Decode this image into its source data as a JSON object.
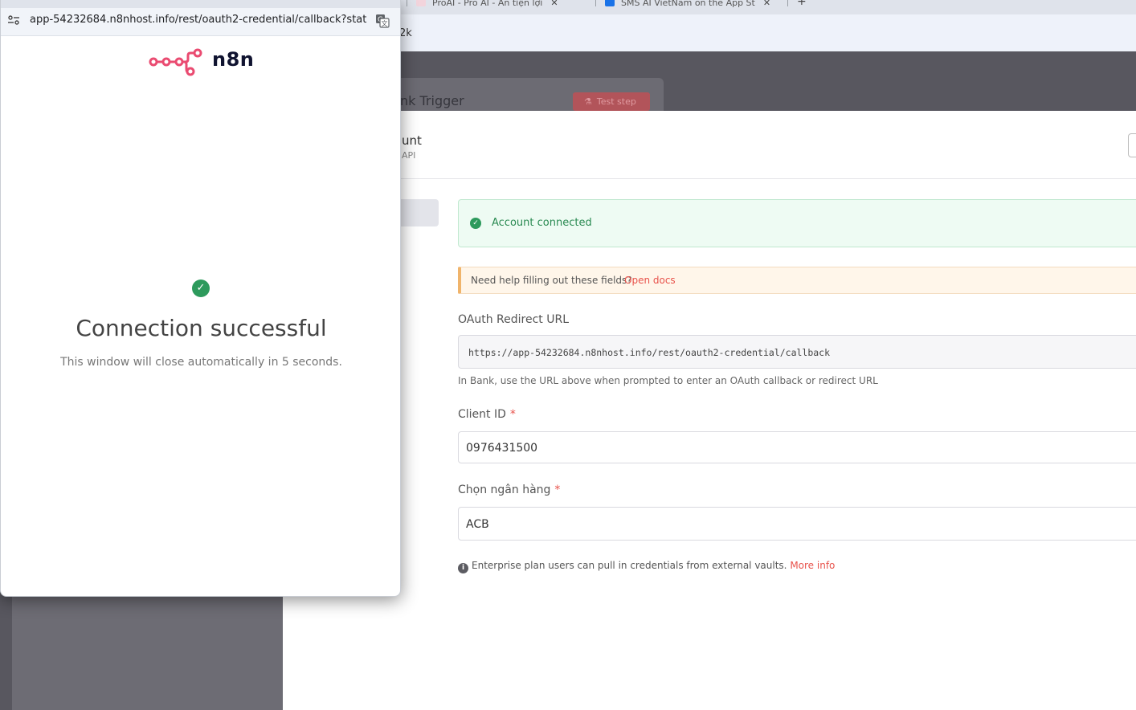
{
  "browser": {
    "tabs": [
      {
        "label": "ProAI - Pro AI - An tiện lợi",
        "color": "#f2d4dc"
      },
      {
        "label": "SMS AI VietNam on the App St",
        "color": "#1a73e8"
      }
    ],
    "background_url_fragment": "2k"
  },
  "popup": {
    "url": "app-54232684.n8nhost.info/rest/oauth2-credential/callback?state...",
    "logo_text": "n8n",
    "title": "Connection successful",
    "subtitle": "This window will close automatically in 5 seconds."
  },
  "ndv": {
    "title": "nk Trigger",
    "test_step_label": "Test step"
  },
  "credential": {
    "title": "unt",
    "subtitle": "API",
    "success_banner": "Account connected",
    "help_text": "Need help filling out these fields?",
    "help_link": "Open docs",
    "redirect_label": "OAuth Redirect URL",
    "redirect_value": "https://app-54232684.n8nhost.info/rest/oauth2-credential/callback",
    "redirect_hint": "In Bank, use the URL above when prompted to enter an OAuth callback or redirect URL",
    "client_id_label": "Client ID",
    "client_id_value": "0976431500",
    "bank_label": "Chọn ngân hàng",
    "bank_value": "ACB",
    "required_mark": "*",
    "enterprise_note": "Enterprise plan users can pull in credentials from external vaults.",
    "enterprise_link": "More info"
  },
  "colors": {
    "brand": "#ea4b71",
    "success": "#2d9a5c",
    "link": "#e8524b"
  }
}
